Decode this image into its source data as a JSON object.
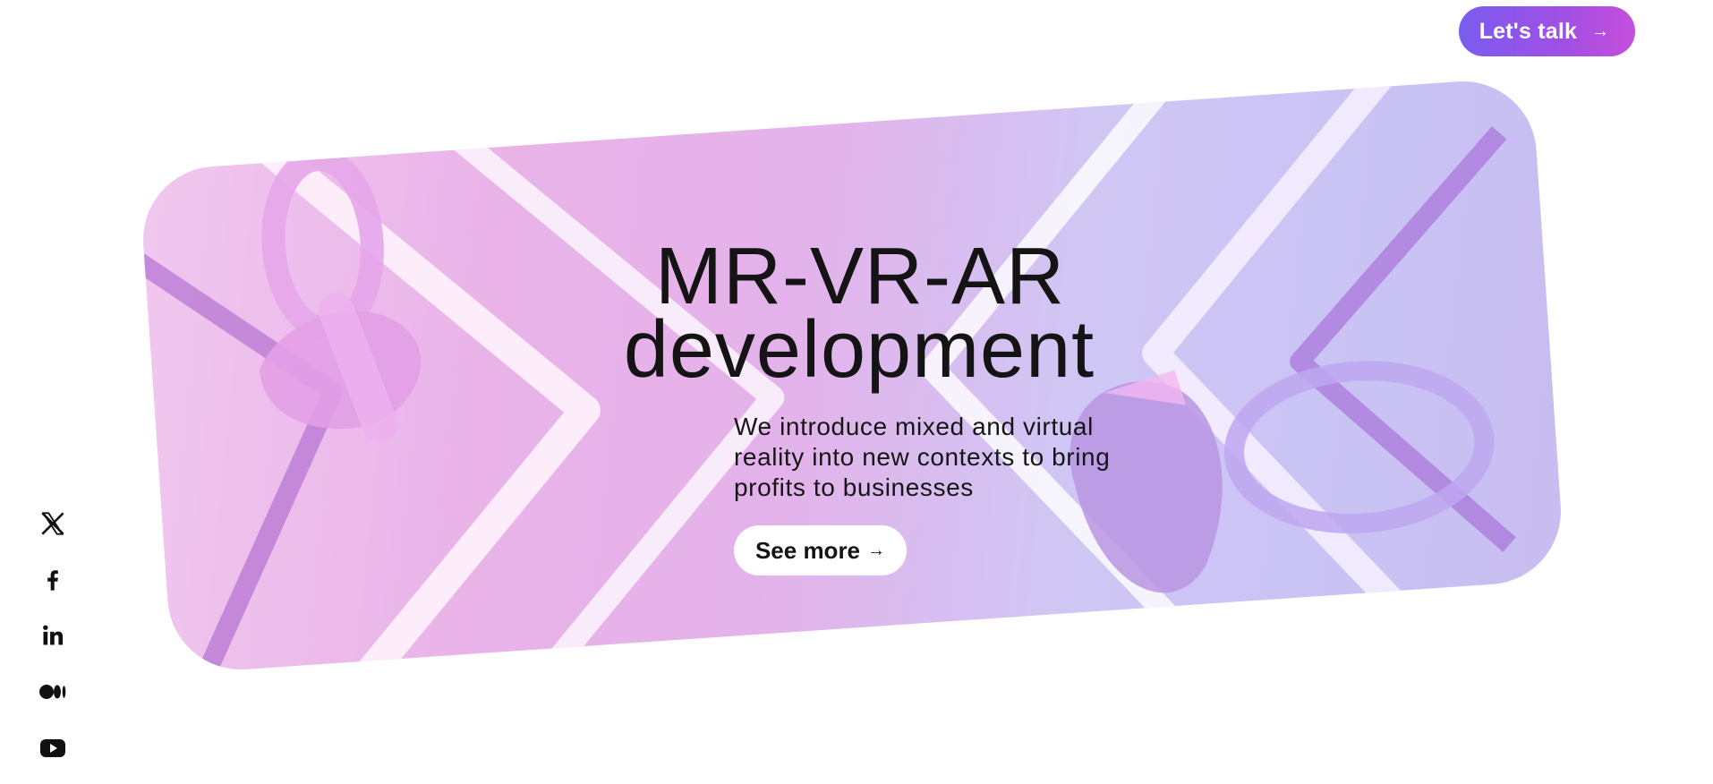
{
  "header": {
    "cta_label": "Let's talk",
    "cta_arrow": "→"
  },
  "hero": {
    "title_line1": "MR-VR-AR",
    "title_line2": "development",
    "description_line1": "We introduce mixed and virtual",
    "description_line2": "reality into new contexts to bring",
    "description_line3": "profits to businesses",
    "button_label": "See more",
    "button_arrow": "→"
  },
  "social": {
    "items": [
      {
        "icon": "x-twitter-icon"
      },
      {
        "icon": "facebook-icon"
      },
      {
        "icon": "linkedin-icon"
      },
      {
        "icon": "medium-icon"
      },
      {
        "icon": "youtube-icon"
      }
    ]
  },
  "colors": {
    "cta_gradient_start": "#7a5cf0",
    "cta_gradient_end": "#c64fdc",
    "hero_pink": "#e9b3e8",
    "hero_lavender": "#c9c3f4",
    "text": "#141414"
  }
}
